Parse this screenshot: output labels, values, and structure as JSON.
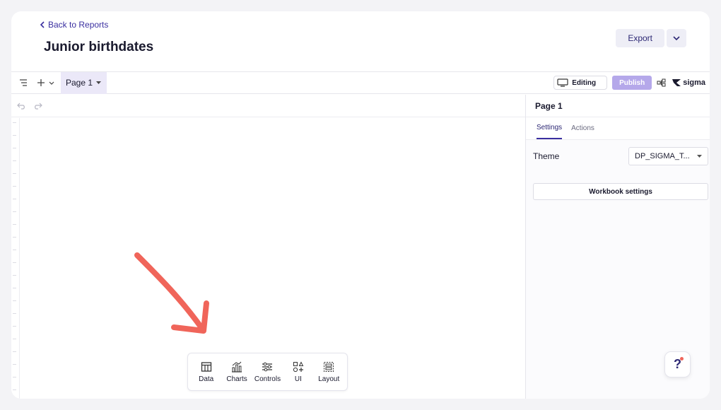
{
  "header": {
    "back_label": "Back to Reports",
    "title": "Junior birthdates",
    "export_label": "Export"
  },
  "toolbar": {
    "page_tab": "Page 1",
    "editing_label": "Editing",
    "publish_label": "Publish",
    "logo_text": "sigma"
  },
  "insert_bar": {
    "items": [
      {
        "label": "Data",
        "icon": "table-icon"
      },
      {
        "label": "Charts",
        "icon": "bar-chart-icon"
      },
      {
        "label": "Controls",
        "icon": "sliders-icon"
      },
      {
        "label": "UI",
        "icon": "shapes-icon"
      },
      {
        "label": "Layout",
        "icon": "layout-icon"
      }
    ]
  },
  "panel": {
    "title": "Page 1",
    "tabs": [
      "Settings",
      "Actions"
    ],
    "active_tab": "Settings",
    "theme_label": "Theme",
    "theme_value": "DP_SIGMA_T...",
    "workbook_settings_label": "Workbook settings"
  },
  "help": {
    "label": "?"
  },
  "colors": {
    "accent": "#3a2fa0",
    "publish": "#b5a8ea",
    "arrow": "#f0655a",
    "notification": "#f0655a"
  }
}
